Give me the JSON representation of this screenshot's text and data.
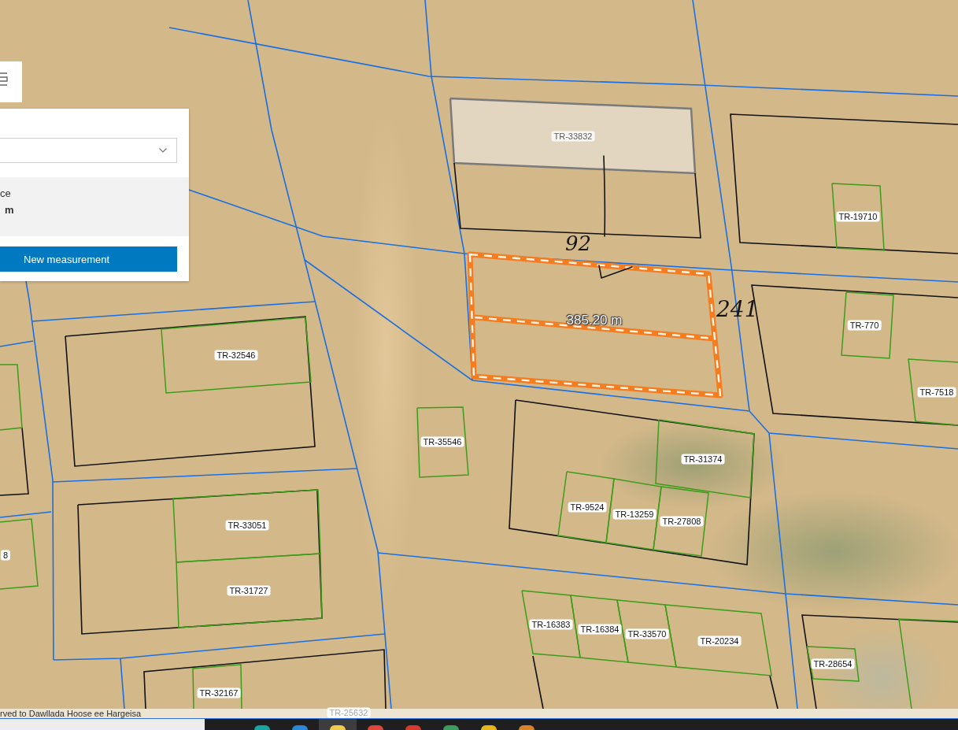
{
  "map_view": {
    "parcel_labels": [
      {
        "text": "TR-33832",
        "selected": true
      },
      {
        "text": "TR-19710",
        "selected": false
      },
      {
        "text": "TR-770",
        "selected": false
      },
      {
        "text": "TR-32546",
        "selected": false
      },
      {
        "text": "TR-7518",
        "selected": false
      },
      {
        "text": "TR-35546",
        "selected": false
      },
      {
        "text": "TR-31374",
        "selected": false
      },
      {
        "text": "TR-9524",
        "selected": false
      },
      {
        "text": "TR-13259",
        "selected": false
      },
      {
        "text": "TR-27808",
        "selected": false
      },
      {
        "text": "TR-33051",
        "selected": false
      },
      {
        "text": "8",
        "selected": false
      },
      {
        "text": "TR-31727",
        "selected": false
      },
      {
        "text": "TR-16383",
        "selected": false
      },
      {
        "text": "TR-16384",
        "selected": false
      },
      {
        "text": "TR-33570",
        "selected": false
      },
      {
        "text": "TR-20234",
        "selected": false
      },
      {
        "text": "TR-28654",
        "selected": false
      },
      {
        "text": "TR-32167",
        "selected": false
      },
      {
        "text": "TR-25632",
        "selected": false
      }
    ],
    "measurement": {
      "label": "385.20 m"
    },
    "handwritten_notes": [
      "92",
      "241"
    ],
    "attribution": "rved to Dawllada Hoose ee Hargeisa"
  },
  "measurement_panel": {
    "result_label": "ce",
    "result_value": "m",
    "button": "New measurement"
  },
  "taskbar": {
    "apps": [
      {
        "color": "#1aa3a3",
        "highlighted": false
      },
      {
        "color": "#2b88d8",
        "highlighted": false
      },
      {
        "color": "#f2c94c",
        "highlighted": true
      },
      {
        "color": "#e0453a",
        "highlighted": false
      },
      {
        "color": "#d93a2b",
        "highlighted": false
      },
      {
        "color": "#3f9b5a",
        "highlighted": false
      },
      {
        "color": "#e8b51a",
        "highlighted": false
      },
      {
        "color": "#d9822b",
        "highlighted": false
      }
    ]
  }
}
